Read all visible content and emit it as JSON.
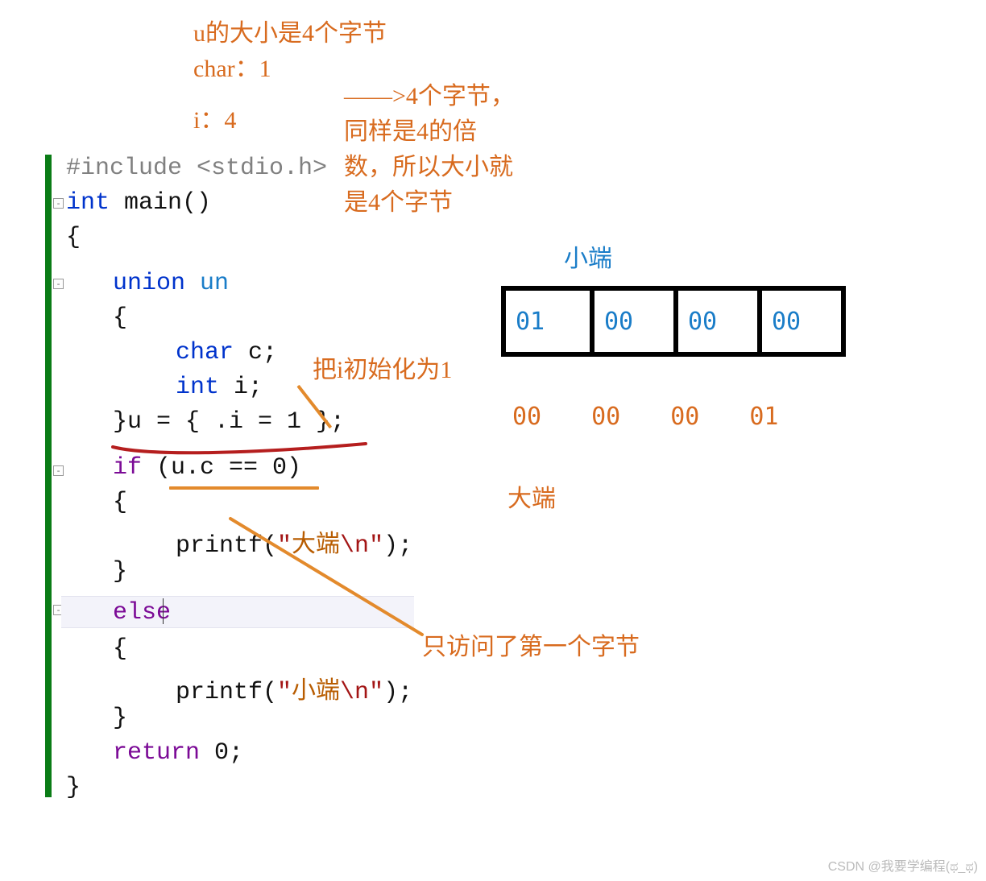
{
  "annotations": {
    "size_header": "u的大小是4个字节",
    "char_label": "char：1",
    "i_label": "i：4",
    "explain_arrow": "——>4个字节，",
    "explain_line2": "同样是4的倍",
    "explain_line3": "数，所以大小就",
    "explain_line4": "是4个字节",
    "init_note": "把i初始化为1",
    "first_byte_note": "只访问了第一个字节",
    "little_endian_label": "小端",
    "big_endian_label": "大端"
  },
  "memory": {
    "little": [
      "01",
      "00",
      "00",
      "00"
    ],
    "big": [
      "00",
      "00",
      "00",
      "01"
    ]
  },
  "code": {
    "l1_pre": "#include ",
    "l1_inc": "<stdio.h>",
    "l2_kw1": "int",
    "l2_fn": " main()",
    "l3": "{",
    "l4_kw": "union",
    "l4_name": " un",
    "l5": "{",
    "l6_kw": "char",
    "l6_rest": " c;",
    "l7_kw": "int",
    "l7_rest": " i;",
    "l8": "}u = { .i = 1 };",
    "l9_kw": "if",
    "l9_rest": " (u.c == 0)",
    "l10": "{",
    "l11_a": "printf(",
    "l11_q1": "\"",
    "l11_cn": "大端",
    "l11_esc": "\\n",
    "l11_q2": "\"",
    "l11_b": ");",
    "l12": "}",
    "l13": "else",
    "l14": "{",
    "l15_a": "printf(",
    "l15_q1": "\"",
    "l15_cn": "小端",
    "l15_esc": "\\n",
    "l15_q2": "\"",
    "l15_b": ");",
    "l16": "}",
    "l17_kw": "return",
    "l17_rest": " 0;",
    "l18": "}"
  },
  "watermark": "CSDN @我要学编程(ಥ_ಥ)"
}
